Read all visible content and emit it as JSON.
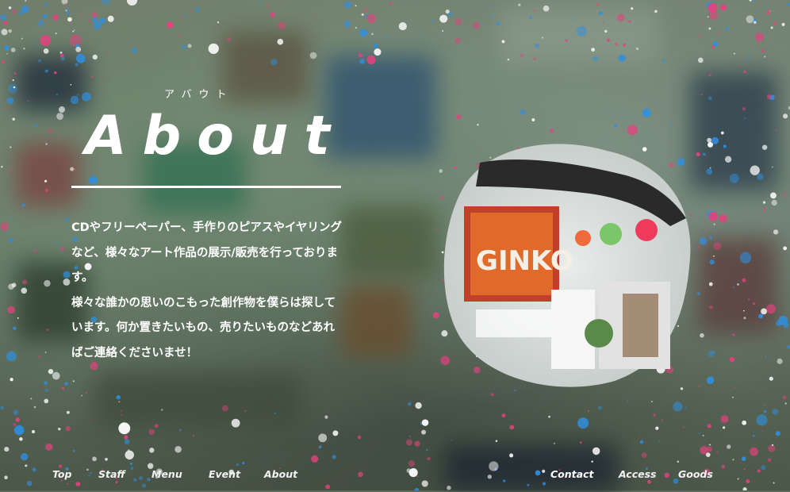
{
  "heading": {
    "kana": "アバウト",
    "title": "About"
  },
  "description": {
    "paragraph1": "CDやフリーペーパー、手作りのピアスやイヤリングなど、様々なアート作品の展示/販売を行っております。",
    "paragraph2": "様々な誰かの思いのこもった創作物を僕らは探しています。何か置きたいもの、売りたいものなどあればご連絡くださいませ！"
  },
  "nav_left": [
    "Top",
    "Staff",
    "Menu",
    "Event",
    "About"
  ],
  "nav_right": [
    "Contact",
    "Access",
    "Goods"
  ],
  "colors": {
    "text": "#ffffff",
    "splatter_pink": "#e4417f",
    "splatter_blue": "#2f8fe0"
  },
  "photo": {
    "sign_text": "GINKO"
  }
}
